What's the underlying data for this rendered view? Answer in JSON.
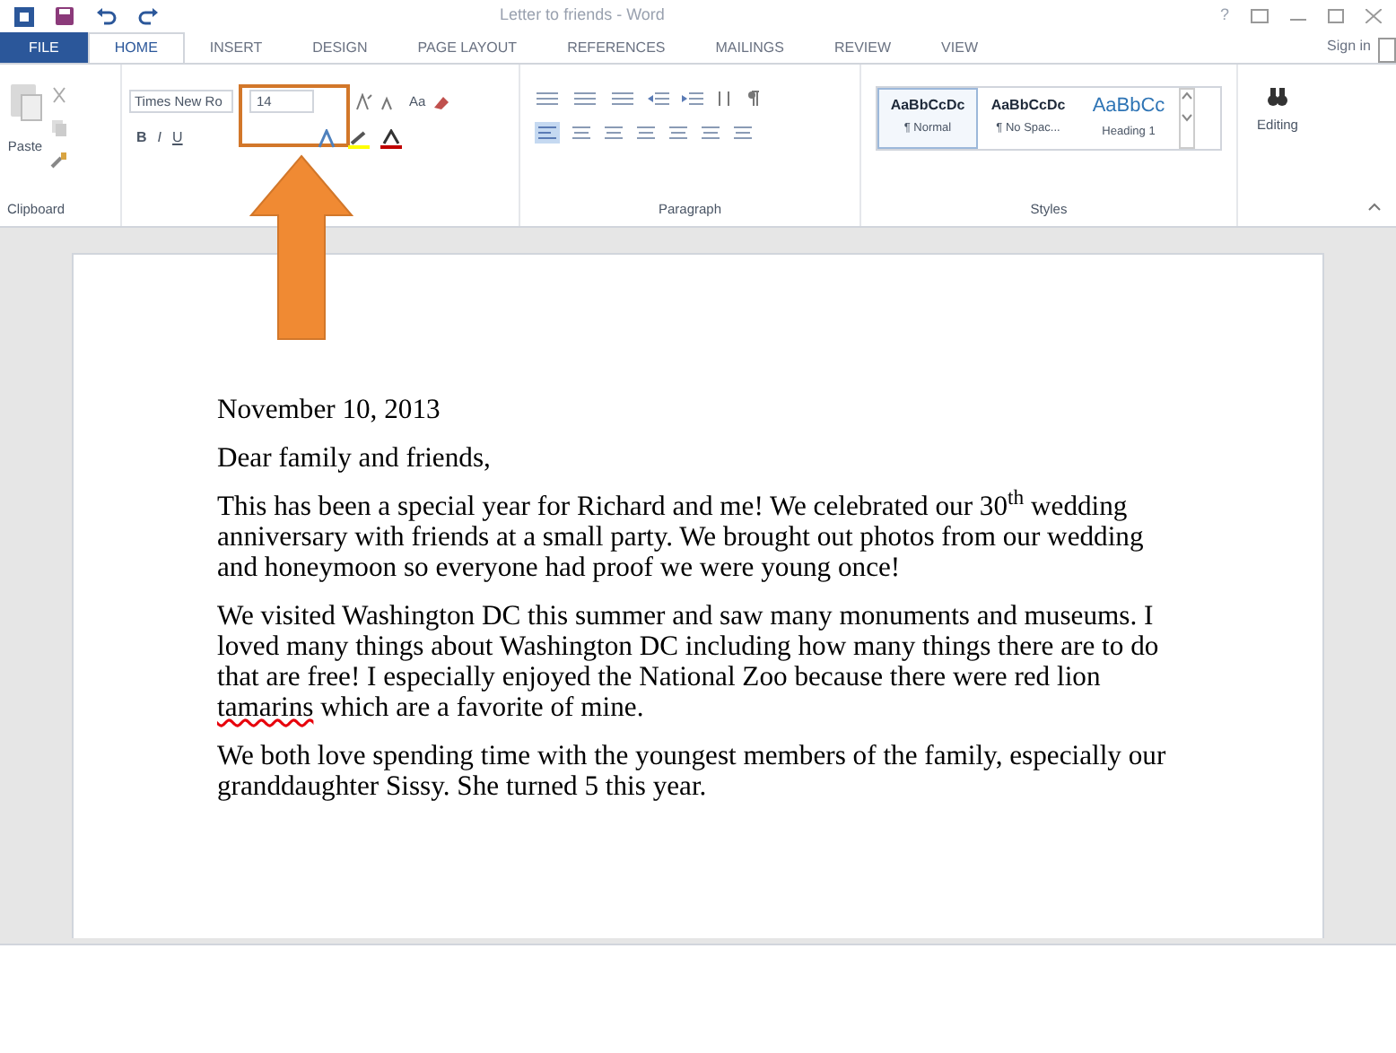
{
  "window": {
    "title": "Letter to friends - Word",
    "controls": [
      "?"
    ]
  },
  "tabs": [
    {
      "label": "FILE",
      "kind": "file",
      "selected": false
    },
    {
      "label": "HOME",
      "kind": "tab",
      "selected": true
    },
    {
      "label": "INSERT",
      "kind": "tab",
      "selected": false
    },
    {
      "label": "DESIGN",
      "kind": "tab",
      "selected": false
    },
    {
      "label": "PAGE LAYOUT",
      "kind": "tab",
      "selected": false
    },
    {
      "label": "REFERENCES",
      "kind": "tab",
      "selected": false
    },
    {
      "label": "MAILINGS",
      "kind": "tab",
      "selected": false
    },
    {
      "label": "REVIEW",
      "kind": "tab",
      "selected": false
    },
    {
      "label": "VIEW",
      "kind": "tab",
      "selected": false
    }
  ],
  "sign_in": "Sign in",
  "ribbon": {
    "clipboard": {
      "paste": "Paste",
      "label": "Clipboard"
    },
    "font": {
      "name": "Times New Ro",
      "size": "14",
      "format_buttons": [
        "B",
        "I",
        "U"
      ],
      "change_case": "Aa"
    },
    "paragraph": {
      "label": "Paragraph"
    },
    "styles": {
      "label": "Styles",
      "items": [
        {
          "preview": "AaBbCcDc",
          "name": "¶ Normal",
          "kind": "body",
          "selected": true
        },
        {
          "preview": "AaBbCcDc",
          "name": "¶ No Spac...",
          "kind": "body",
          "selected": false
        },
        {
          "preview": "AaBbCc",
          "name": "Heading 1",
          "kind": "heading",
          "selected": false
        }
      ]
    },
    "editing": {
      "label": "Editing"
    }
  },
  "document": {
    "paragraphs": [
      [
        {
          "text": "November 10, 2013"
        }
      ],
      [
        {
          "text": "Dear family and friends,"
        }
      ],
      [
        {
          "text": "This has been a special year for Richard and me! We celebrated our 30$^{th}$ wedding anniversary with friends at a small party.  We brought out photos from our wedding and honeymoon so everyone had proof we were young once!"
        }
      ],
      [
        {
          "text": "We visited Washington DC this summer and saw many monuments and museums.  I loved many things about Washington DC including how many things there are to do that are free!  I especially enjoyed the National Zoo because there were red lion "
        },
        {
          "text": "tamarins",
          "misspelled": true
        },
        {
          "text": " which are a favorite of mine."
        }
      ],
      [
        {
          "text": "We both love spending time with the youngest members of the family, especially our granddaughter Sissy.  She turned 5 this year."
        }
      ]
    ]
  }
}
